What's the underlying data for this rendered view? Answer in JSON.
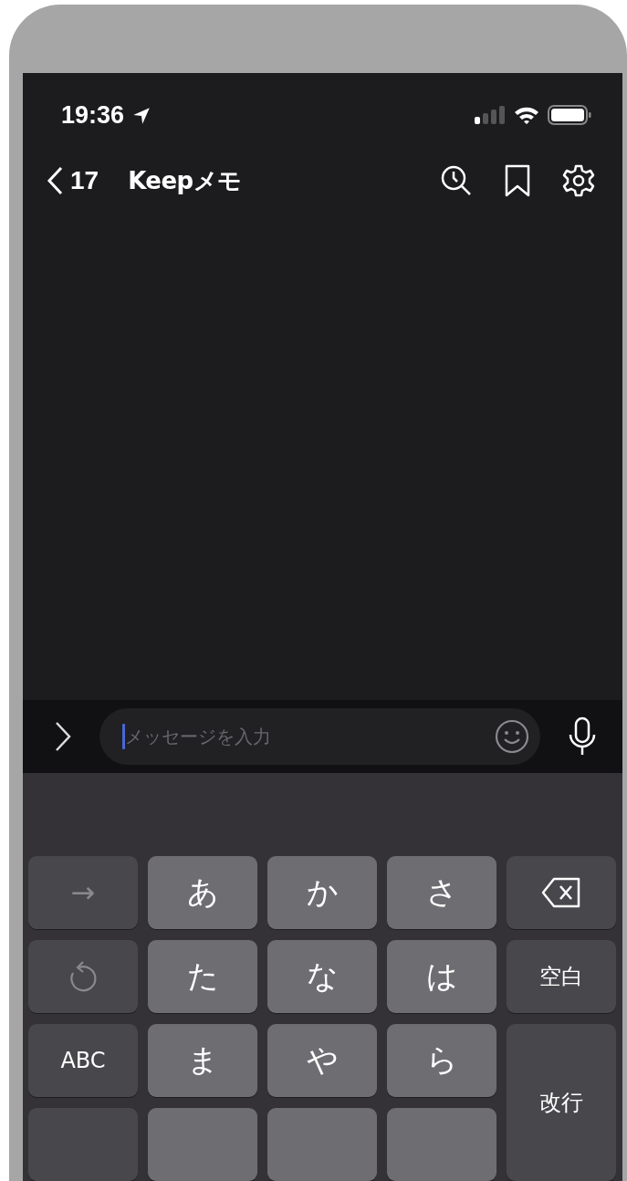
{
  "status_bar": {
    "time": "19:36"
  },
  "nav": {
    "back_count": "17",
    "title": "Keepメモ"
  },
  "message_input": {
    "placeholder": "メッセージを入力"
  },
  "keyboard": {
    "keys": [
      {
        "kind": "arrow",
        "label": "→"
      },
      {
        "kind": "char",
        "label": "あ"
      },
      {
        "kind": "char",
        "label": "か"
      },
      {
        "kind": "char",
        "label": "さ"
      },
      {
        "kind": "backspace"
      },
      {
        "kind": "undo"
      },
      {
        "kind": "char",
        "label": "た"
      },
      {
        "kind": "char",
        "label": "な"
      },
      {
        "kind": "char",
        "label": "は"
      },
      {
        "kind": "function",
        "label": "空白"
      },
      {
        "kind": "function",
        "label": "ABC"
      },
      {
        "kind": "char",
        "label": "ま"
      },
      {
        "kind": "char",
        "label": "や"
      },
      {
        "kind": "char",
        "label": "ら"
      },
      {
        "kind": "return",
        "label": "改行"
      },
      {
        "kind": "function"
      },
      {
        "kind": "char"
      },
      {
        "kind": "char"
      },
      {
        "kind": "char"
      }
    ]
  }
}
